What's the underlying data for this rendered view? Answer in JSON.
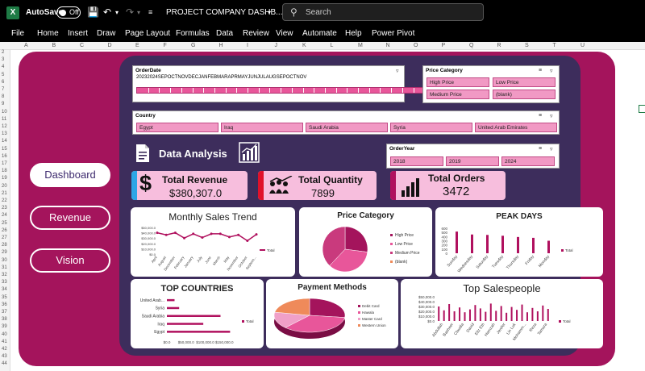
{
  "titlebar": {
    "app_logo": "X",
    "autosave_label": "AutoSave",
    "autosave_state": "Off",
    "document_title": "PROJECT COMPANY DASHB...",
    "search_placeholder": "Search"
  },
  "menu": [
    "File",
    "Home",
    "Insert",
    "Draw",
    "Page Layout",
    "Formulas",
    "Data",
    "Review",
    "View",
    "Automate",
    "Help",
    "Power Pivot"
  ],
  "columns": [
    "A",
    "B",
    "C",
    "D",
    "E",
    "F",
    "G",
    "H",
    "I",
    "J",
    "K",
    "L",
    "M",
    "N",
    "O",
    "P",
    "Q",
    "R",
    "S",
    "T",
    "U"
  ],
  "rows": [
    "2",
    "3",
    "4",
    "5",
    "6",
    "7",
    "8",
    "9",
    "10",
    "11",
    "12",
    "13",
    "14",
    "15",
    "16",
    "17",
    "18",
    "19",
    "20",
    "21",
    "22",
    "23",
    "24",
    "25",
    "26",
    "27",
    "28",
    "29",
    "30",
    "31",
    "32",
    "33",
    "34",
    "35",
    "36",
    "37",
    "38",
    "39",
    "40",
    "41",
    "42",
    "43",
    "44"
  ],
  "nav": {
    "dashboard": "Dashboard",
    "revenue": "Revenue",
    "vision": "Vision"
  },
  "slicers": {
    "order_date": {
      "title": "OrderDate",
      "years": [
        "2023",
        "2024"
      ],
      "months": [
        "SEP",
        "OCT",
        "NOV",
        "DEC",
        "JAN",
        "FEB",
        "MAR",
        "APR",
        "MAY",
        "JUN",
        "JUL",
        "AUG",
        "SEP",
        "OCT",
        "NOV"
      ]
    },
    "price_category": {
      "title": "Price Category",
      "items": [
        "High Price",
        "Low Price",
        "Medium Price",
        "(blank)"
      ]
    },
    "country": {
      "title": "Country",
      "items": [
        "Egypt",
        "Iraq",
        "Saudi Arabia",
        "Syria",
        "United Arab Emirates"
      ]
    },
    "order_year": {
      "title": "OrderYear",
      "items": [
        "2018",
        "2019",
        "2024"
      ]
    }
  },
  "section_title": "Data Analysis",
  "kpis": {
    "revenue": {
      "label": "Total Revenue",
      "value": "$380,307.0"
    },
    "quantity": {
      "label": "Total Quantity",
      "value": "7899"
    },
    "orders": {
      "label": "Total Orders",
      "value": "3472"
    }
  },
  "colors": {
    "accent": "#a4145c",
    "panel": "#3d2d5c",
    "bar": "#b0105e",
    "card": "#f7bedd"
  },
  "chart_data": [
    {
      "type": "line",
      "title": "Monthly Sales Trend",
      "categories": [
        "April",
        "August",
        "December",
        "February",
        "January",
        "July",
        "June",
        "March",
        "May",
        "November",
        "October",
        "Septem..."
      ],
      "series": [
        {
          "name": "Total",
          "values": [
            40000,
            36000,
            40000,
            30000,
            38000,
            31000,
            38000,
            38000,
            32000,
            36000,
            25000,
            37000
          ]
        }
      ],
      "y_ticks": [
        "$50,000.0",
        "$40,000.0",
        "$30,000.0",
        "$20,000.0",
        "$10,000.0",
        "$0.0"
      ],
      "ylim": [
        0,
        50000
      ]
    },
    {
      "type": "pie",
      "title": "Price Category",
      "categories": [
        "High Price",
        "Low Price",
        "Medium Price",
        "(blank)"
      ],
      "values": [
        27,
        35,
        38,
        0
      ],
      "colors": [
        "#a4145c",
        "#e8569a",
        "#c93a7d",
        "#ef8a5a"
      ]
    },
    {
      "type": "bar",
      "title": "PEAK DAYS",
      "categories": [
        "Sunday",
        "Wednesday",
        "Saturday",
        "Tuesday",
        "Thursday",
        "Friday",
        "Monday"
      ],
      "series": [
        {
          "name": "Total",
          "values": [
            520,
            450,
            440,
            420,
            390,
            370,
            300
          ]
        }
      ],
      "y_ticks": [
        "600",
        "500",
        "400",
        "300",
        "200",
        "100",
        "0"
      ],
      "ylim": [
        0,
        600
      ]
    },
    {
      "type": "bar",
      "title": "TOP COUNTRIES",
      "categories": [
        "United Arab...",
        "Syria",
        "Saudi Arabia",
        "Iraq",
        "Egypt"
      ],
      "series": [
        {
          "name": "Total",
          "values": [
            20000,
            32000,
            140000,
            95000,
            165000
          ]
        }
      ],
      "x_ticks": [
        "$0.0",
        "$50,000.0",
        "$100,000.0",
        "$150,000.0"
      ],
      "xlim": [
        0,
        200000
      ]
    },
    {
      "type": "pie",
      "title": "Payment Methods",
      "categories": [
        "Debit Card",
        "Hawala",
        "Master Card",
        "Western Union"
      ],
      "values": [
        27,
        35,
        16,
        22
      ],
      "colors": [
        "#a4145c",
        "#e8569a",
        "#f0a0c8",
        "#ef8a5a"
      ]
    },
    {
      "type": "bar",
      "title": "Top Salespeople",
      "categories": [
        "Abdullah",
        "Basheer",
        "Claudia",
        "David",
        "Eliz Eth",
        "Hamzah",
        "Jenifer",
        "Lin Luk",
        "Mohamm...",
        "Reza",
        "Tamara"
      ],
      "series": [
        {
          "name": "Total",
          "values": [
            30000,
            22000,
            35000,
            20000,
            28000,
            18000,
            24000,
            33000,
            26000,
            19000,
            36000,
            21000,
            31000,
            17000,
            29000,
            23000,
            34000,
            18000,
            27000,
            20000,
            32000,
            25000
          ]
        }
      ],
      "y_ticks": [
        "$50,000.0",
        "$40,000.0",
        "$30,000.0",
        "$20,000.0",
        "$10,000.0",
        "$0.0"
      ],
      "ylim": [
        0,
        50000
      ]
    }
  ]
}
